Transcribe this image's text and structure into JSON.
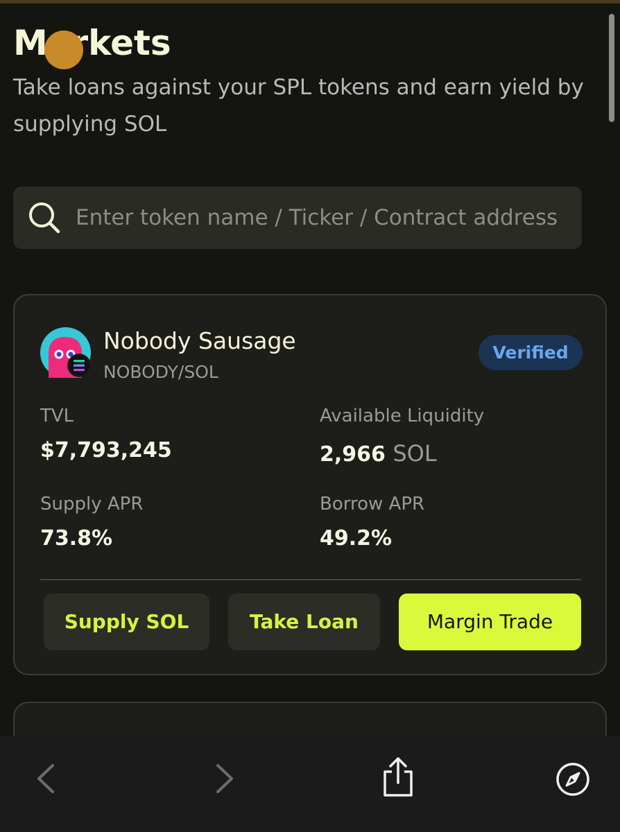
{
  "header": {
    "title": "Markets",
    "subtitle": "Take loans against your SPL tokens and earn yield by supplying SOL"
  },
  "search": {
    "placeholder": "Enter token name / Ticker / Contract address",
    "value": "",
    "icon": "search-icon"
  },
  "markets": [
    {
      "name": "Nobody Sausage",
      "pair": "NOBODY/SOL",
      "badge": "Verified",
      "tvl_label": "TVL",
      "tvl": "$7,793,245",
      "liquidity_label": "Available Liquidity",
      "liquidity_value": "2,966",
      "liquidity_unit": "SOL",
      "supply_apr_label": "Supply APR",
      "supply_apr": "73.8%",
      "borrow_apr_label": "Borrow APR",
      "borrow_apr": "49.2%",
      "actions": {
        "supply": "Supply SOL",
        "loan": "Take Loan",
        "margin": "Margin Trade"
      }
    }
  ],
  "browser_toolbar": {
    "icons": [
      "back-icon",
      "forward-icon",
      "share-icon",
      "compass-icon"
    ]
  },
  "colors": {
    "background": "#141411",
    "accent": "#d9f93a",
    "badge_bg": "#1b3454",
    "badge_text": "#6aa7ee",
    "card_bg": "#1d1e19"
  }
}
